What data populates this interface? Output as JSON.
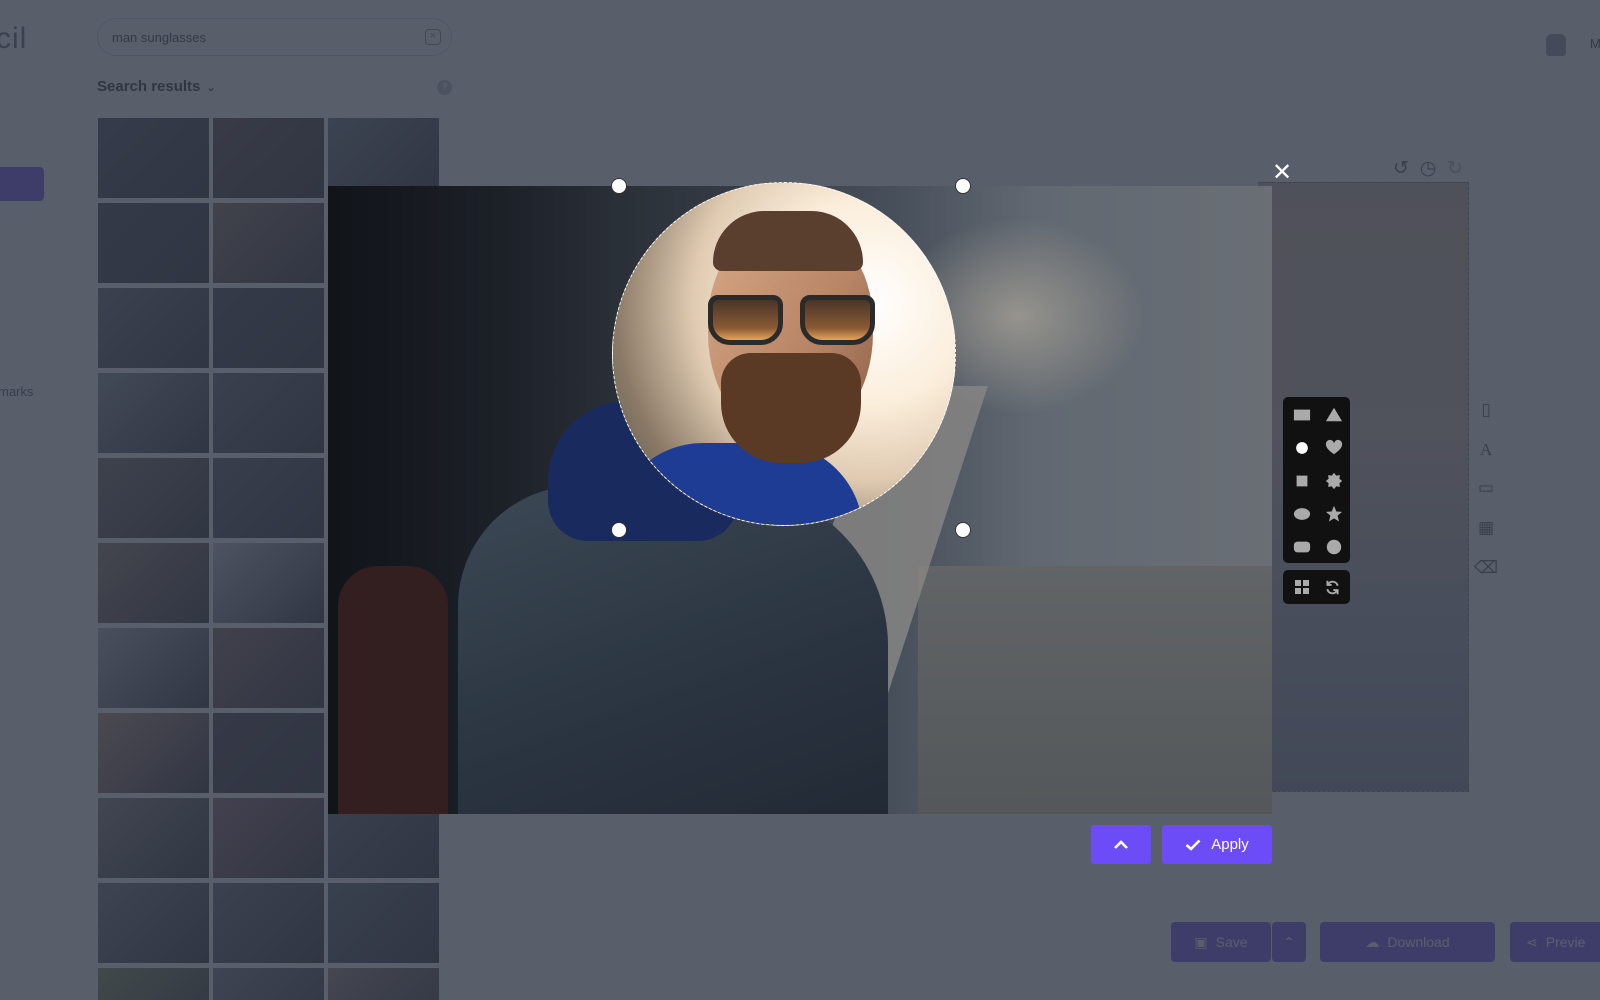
{
  "app": {
    "logo_fragment": "cil",
    "nav_partial_label": "marks",
    "user_initial": "M"
  },
  "search": {
    "value": "man sunglasses",
    "clear_icon": "clear-icon"
  },
  "results": {
    "heading": "Search results",
    "help_icon": "?",
    "thumb_colors": [
      [
        "#3b4150",
        "#4a4037",
        "#5b6a74"
      ],
      [
        "#34383f",
        "#7c6a52",
        "#2a3036"
      ],
      [
        "#566169",
        "#3a3b40",
        "#6b7480"
      ],
      [
        "#7e8b91",
        "#585b60",
        "#3e434b"
      ],
      [
        "#6b6558",
        "#4b4f56",
        "#5a626b"
      ],
      [
        "#8c7a62",
        "#bcc2c7",
        "#9aa1a9"
      ],
      [
        "#a9aeb2",
        "#7a5f52",
        "#8d8f93"
      ],
      [
        "#b08d73",
        "#3a3437",
        "#6f757d"
      ],
      [
        "#7d7a76",
        "#8b5f62",
        "#4f5861"
      ],
      [
        "#6a6e73",
        "#595f63",
        "#4b5a63"
      ],
      [
        "#7d8a4b",
        "#6c7278",
        "#8c7e6c"
      ]
    ]
  },
  "toolbar": {
    "undo_icon": "undo-icon",
    "history_icon": "history-icon",
    "redo_icon": "redo-icon"
  },
  "right_tools": [
    "page-icon",
    "text-icon",
    "window-icon",
    "grid-icon",
    "trash-icon"
  ],
  "editor": {
    "close_icon": "close-icon",
    "shapes": [
      [
        "rectangle",
        "triangle"
      ],
      [
        "circle",
        "heart"
      ],
      [
        "square",
        "badge"
      ],
      [
        "ellipse",
        "star"
      ],
      [
        "rounded-rectangle",
        "octagon"
      ]
    ],
    "selected_shape": "circle",
    "utilities": [
      "grid-icon",
      "refresh-icon"
    ],
    "apply_label": "Apply",
    "collapse_icon": "chevron-up-icon"
  },
  "bottom_bar": {
    "save_label": "Save",
    "download_label": "Download",
    "preview_label": "Previe"
  },
  "colors": {
    "accent": "#6c4cf6",
    "overlay": "rgba(52,58,74,0.82)",
    "panel": "#111111"
  }
}
